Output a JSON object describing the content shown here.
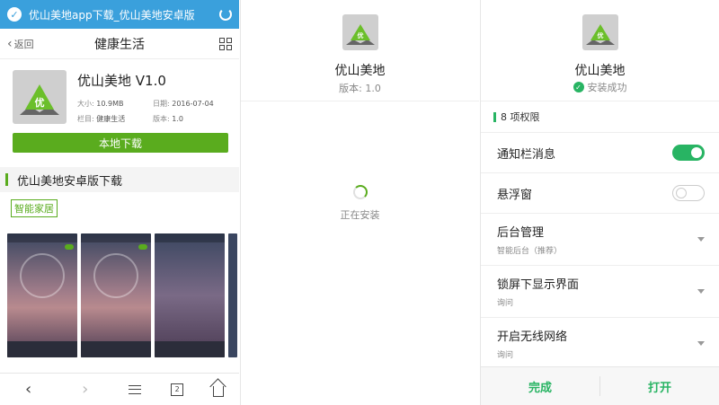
{
  "browser": {
    "url_title": "优山美地app下载_优山美地安卓版",
    "back_label": "返回",
    "page_title": "健康生活",
    "tab_count": "2"
  },
  "app": {
    "name_version": "优山美地 V1.0",
    "icon_text": "优",
    "size_label": "大小:",
    "size": "10.9MB",
    "date_label": "日期:",
    "date": "2016-07-04",
    "category_label": "栏目:",
    "category": "健康生活",
    "version_label": "版本:",
    "version": "1.0",
    "download_button": "本地下载",
    "section_title": "优山美地安卓版下载",
    "tag": "智能家居"
  },
  "installing": {
    "app_name": "优山美地",
    "version": "版本: 1.0",
    "status": "正在安装"
  },
  "installed": {
    "app_name": "优山美地",
    "status": "安装成功",
    "permissions_header": "8 项权限",
    "permissions": [
      {
        "title": "通知栏消息",
        "type": "toggle",
        "enabled": true
      },
      {
        "title": "悬浮窗",
        "type": "toggle",
        "enabled": false
      },
      {
        "title": "后台管理",
        "sub": "智能后台（推荐）",
        "type": "select"
      },
      {
        "title": "锁屏下显示界面",
        "sub": "询问",
        "type": "select"
      },
      {
        "title": "开启无线网络",
        "sub": "询问",
        "type": "select"
      }
    ],
    "done_button": "完成",
    "open_button": "打开"
  },
  "colors": {
    "browser_bar": "#3aa0dc",
    "download_green": "#5aac1e",
    "install_green": "#28b463"
  }
}
